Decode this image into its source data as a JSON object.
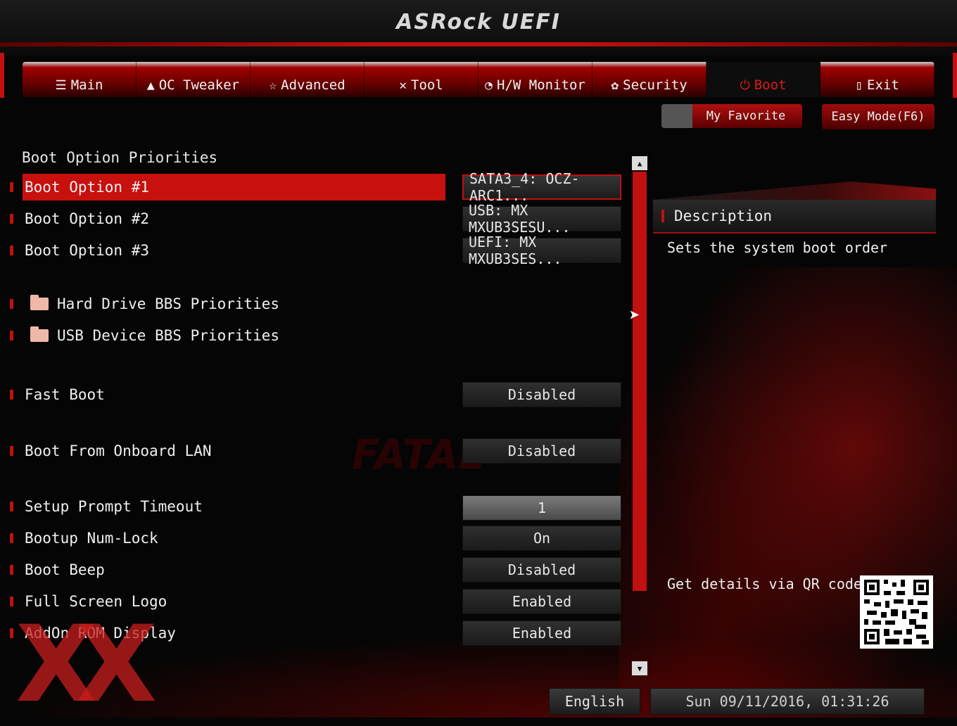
{
  "app": {
    "title": "ASRock UEFI"
  },
  "tabs": [
    {
      "label": "Main",
      "icon": "list-icon"
    },
    {
      "label": "OC Tweaker",
      "icon": "rocket-icon"
    },
    {
      "label": "Advanced",
      "icon": "star-icon"
    },
    {
      "label": "Tool",
      "icon": "tools-icon"
    },
    {
      "label": "H/W Monitor",
      "icon": "monitor-icon"
    },
    {
      "label": "Security",
      "icon": "shield-icon"
    },
    {
      "label": "Boot",
      "icon": "power-icon",
      "active": true
    },
    {
      "label": "Exit",
      "icon": "exit-icon"
    }
  ],
  "buttons": {
    "favorite": "My Favorite",
    "easy_mode": "Easy Mode(F6)"
  },
  "content": {
    "section_title": "Boot Option Priorities",
    "boot_options": [
      {
        "label": "Boot Option #1",
        "value": "SATA3_4: OCZ-ARC1..."
      },
      {
        "label": "Boot Option #2",
        "value": "USB: MX MXUB3SESU..."
      },
      {
        "label": "Boot Option #3",
        "value": "UEFI: MX MXUB3SES..."
      }
    ],
    "submenus": [
      {
        "label": "Hard Drive BBS Priorities"
      },
      {
        "label": "USB Device BBS Priorities"
      }
    ],
    "settings": [
      {
        "label": "Fast Boot",
        "value": "Disabled"
      },
      {
        "label": "Boot From Onboard LAN",
        "value": "Disabled"
      },
      {
        "label": "Setup Prompt Timeout",
        "value": "1"
      },
      {
        "label": "Bootup Num-Lock",
        "value": "On"
      },
      {
        "label": "Boot Beep",
        "value": "Disabled"
      },
      {
        "label": "Full Screen Logo",
        "value": "Enabled"
      },
      {
        "label": "AddOn ROM Display",
        "value": "Enabled"
      }
    ]
  },
  "description": {
    "heading": "Description",
    "text": "Sets the system boot order",
    "qr_label": "Get details via QR code"
  },
  "footer": {
    "language": "English",
    "datetime": "Sun 09/11/2016, 01:31:26"
  },
  "colors": {
    "accent": "#c01010",
    "background": "#050505"
  }
}
